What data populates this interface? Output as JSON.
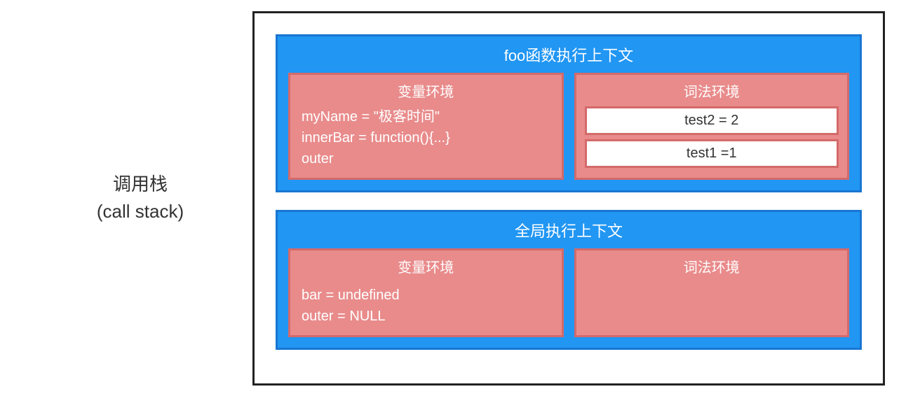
{
  "label": {
    "line1": "调用栈",
    "line2": "(call stack)"
  },
  "contexts": [
    {
      "title": "foo函数执行上下文",
      "varEnv": {
        "title": "变量环境",
        "lines": [
          "myName = \"极客时间\"",
          "innerBar = function(){...}",
          "outer"
        ]
      },
      "lexEnv": {
        "title": "词法环境",
        "items": [
          "test2 = 2",
          "test1 =1"
        ]
      }
    },
    {
      "title": "全局执行上下文",
      "varEnv": {
        "title": "变量环境",
        "lines": [
          "bar =  undefined",
          "outer = NULL"
        ]
      },
      "lexEnv": {
        "title": "词法环境",
        "items": []
      }
    }
  ]
}
